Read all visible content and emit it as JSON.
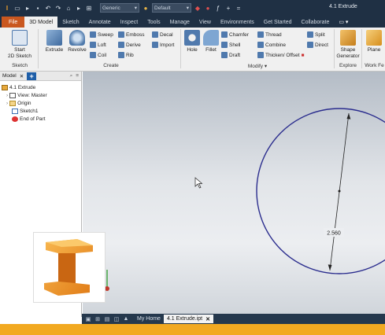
{
  "titlebar": {
    "app_icon": "I",
    "quick_access_icons": [
      "new-icon",
      "open-icon",
      "save-icon",
      "undo-icon",
      "redo-icon",
      "home-icon",
      "select-icon",
      "measure-icon"
    ],
    "material_combo": "Generic",
    "appearance_combo": "Default",
    "document_title": "4.1 Extrude"
  },
  "tabs": [
    "File",
    "3D Model",
    "Sketch",
    "Annotate",
    "Inspect",
    "Tools",
    "Manage",
    "View",
    "Environments",
    "Get Started",
    "Collaborate"
  ],
  "active_tab": "3D Model",
  "ribbon": {
    "sketch": {
      "start_label": "Start\n2D Sketch",
      "group": "Sketch"
    },
    "create": {
      "group": "Create",
      "extrude": "Extrude",
      "revolve": "Revolve",
      "sweep": "Sweep",
      "loft": "Loft",
      "coil": "Coil",
      "emboss": "Emboss",
      "derive": "Derive",
      "rib": "Rib",
      "decal": "Decal",
      "import": "Import"
    },
    "modify": {
      "group": "Modify",
      "hole": "Hole",
      "fillet": "Fillet",
      "chamfer": "Chamfer",
      "shell": "Shell",
      "draft": "Draft",
      "thread": "Thread",
      "combine": "Combine",
      "thicken": "Thicken/ Offset",
      "split": "Split",
      "direct": "Direct"
    },
    "explore": {
      "group": "Explore",
      "shape_generator": "Shape\nGenerator"
    },
    "work_features": {
      "group": "Work Fe",
      "plane": "Plane"
    }
  },
  "browser": {
    "tab_label": "Model",
    "items": [
      {
        "label": "4.1 Extrude",
        "icon": "part-icon"
      },
      {
        "label": "View: Master",
        "icon": "view-icon"
      },
      {
        "label": "Origin",
        "icon": "folder-icon"
      },
      {
        "label": "Sketch1",
        "icon": "sketch-icon"
      },
      {
        "label": "End of Part",
        "icon": "end-of-part-icon"
      }
    ]
  },
  "viewport": {
    "dimension_value": "2.560",
    "circle_color": "#2b2d8e"
  },
  "docbar": {
    "home_label": "My Home",
    "open_doc": "4.1 Extrude.ipt"
  },
  "colors": {
    "file_tab": "#c9571f",
    "footer": "#f2a921",
    "titlebar": "#1f3044"
  }
}
